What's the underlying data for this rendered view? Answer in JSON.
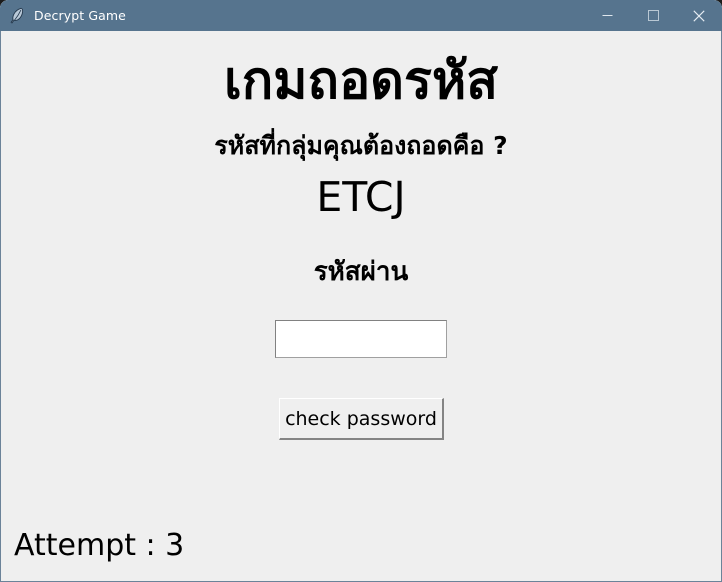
{
  "window": {
    "title": "Decrypt Game",
    "icon": "feather-icon",
    "titlebar_color": "#56748E",
    "background_color": "#EFEFEF",
    "controls": {
      "minimize": "−",
      "maximize": "□",
      "close": "×"
    }
  },
  "content": {
    "heading": "เกมถอดรหัส",
    "subtitle": "รหัสที่กลุ่มคุณต้องถอดคือ ?",
    "code": "ETCJ",
    "password_label": "รหัสผ่าน",
    "password_value": "",
    "password_placeholder": "",
    "check_button_label": "check password",
    "attempt_text": "Attempt : 3",
    "attempt_count": 3
  }
}
